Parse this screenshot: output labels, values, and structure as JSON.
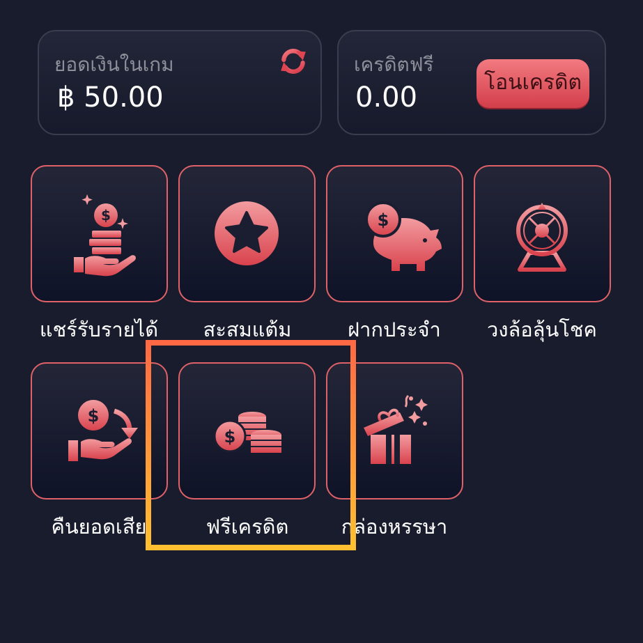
{
  "balance_card": {
    "label": "ยอดเงินในเกม",
    "value": "฿ 50.00",
    "refresh_icon": "refresh-icon"
  },
  "credit_card": {
    "label": "เครดิตฟรี",
    "value": "0.00",
    "transfer_label": "โอนเครดิต"
  },
  "menu": {
    "items": [
      {
        "label": "แชร์รับรายได้",
        "icon": "coins-hand-icon"
      },
      {
        "label": "สะสมแต้ม",
        "icon": "star-icon"
      },
      {
        "label": "ฝากประจำ",
        "icon": "piggy-bank-icon"
      },
      {
        "label": "วงล้อลุ้นโชค",
        "icon": "prize-wheel-icon"
      },
      {
        "label": "คืนยอดเสีย",
        "icon": "cashback-icon"
      },
      {
        "label": "ฟรีเครดิต",
        "icon": "coin-stack-icon"
      },
      {
        "label": "กล่องหรรษา",
        "icon": "gift-box-icon"
      }
    ]
  },
  "highlighted_item": "ฟรีเครดิต",
  "colors": {
    "background": "#181c2d",
    "accent": "#e06268",
    "button": "#d33e4b",
    "highlight": "#ffa43a"
  }
}
